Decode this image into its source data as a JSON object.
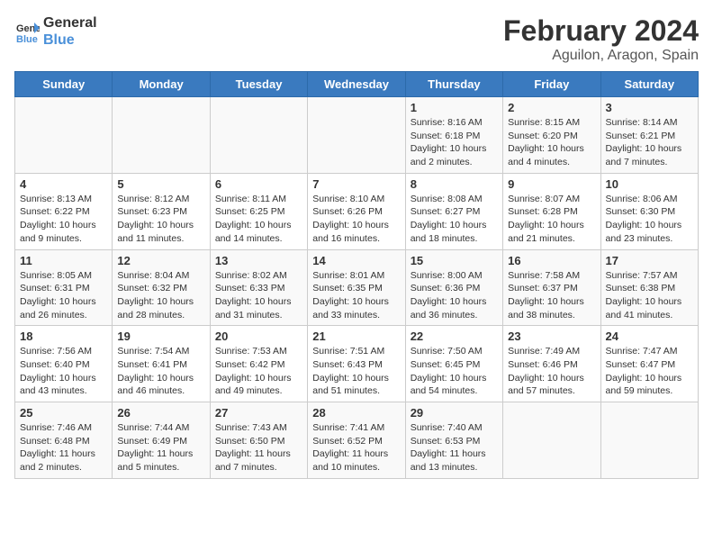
{
  "header": {
    "logo_line1": "General",
    "logo_line2": "Blue",
    "month_year": "February 2024",
    "location": "Aguilon, Aragon, Spain"
  },
  "weekdays": [
    "Sunday",
    "Monday",
    "Tuesday",
    "Wednesday",
    "Thursday",
    "Friday",
    "Saturday"
  ],
  "weeks": [
    [
      {
        "day": "",
        "info": ""
      },
      {
        "day": "",
        "info": ""
      },
      {
        "day": "",
        "info": ""
      },
      {
        "day": "",
        "info": ""
      },
      {
        "day": "1",
        "info": "Sunrise: 8:16 AM\nSunset: 6:18 PM\nDaylight: 10 hours\nand 2 minutes."
      },
      {
        "day": "2",
        "info": "Sunrise: 8:15 AM\nSunset: 6:20 PM\nDaylight: 10 hours\nand 4 minutes."
      },
      {
        "day": "3",
        "info": "Sunrise: 8:14 AM\nSunset: 6:21 PM\nDaylight: 10 hours\nand 7 minutes."
      }
    ],
    [
      {
        "day": "4",
        "info": "Sunrise: 8:13 AM\nSunset: 6:22 PM\nDaylight: 10 hours\nand 9 minutes."
      },
      {
        "day": "5",
        "info": "Sunrise: 8:12 AM\nSunset: 6:23 PM\nDaylight: 10 hours\nand 11 minutes."
      },
      {
        "day": "6",
        "info": "Sunrise: 8:11 AM\nSunset: 6:25 PM\nDaylight: 10 hours\nand 14 minutes."
      },
      {
        "day": "7",
        "info": "Sunrise: 8:10 AM\nSunset: 6:26 PM\nDaylight: 10 hours\nand 16 minutes."
      },
      {
        "day": "8",
        "info": "Sunrise: 8:08 AM\nSunset: 6:27 PM\nDaylight: 10 hours\nand 18 minutes."
      },
      {
        "day": "9",
        "info": "Sunrise: 8:07 AM\nSunset: 6:28 PM\nDaylight: 10 hours\nand 21 minutes."
      },
      {
        "day": "10",
        "info": "Sunrise: 8:06 AM\nSunset: 6:30 PM\nDaylight: 10 hours\nand 23 minutes."
      }
    ],
    [
      {
        "day": "11",
        "info": "Sunrise: 8:05 AM\nSunset: 6:31 PM\nDaylight: 10 hours\nand 26 minutes."
      },
      {
        "day": "12",
        "info": "Sunrise: 8:04 AM\nSunset: 6:32 PM\nDaylight: 10 hours\nand 28 minutes."
      },
      {
        "day": "13",
        "info": "Sunrise: 8:02 AM\nSunset: 6:33 PM\nDaylight: 10 hours\nand 31 minutes."
      },
      {
        "day": "14",
        "info": "Sunrise: 8:01 AM\nSunset: 6:35 PM\nDaylight: 10 hours\nand 33 minutes."
      },
      {
        "day": "15",
        "info": "Sunrise: 8:00 AM\nSunset: 6:36 PM\nDaylight: 10 hours\nand 36 minutes."
      },
      {
        "day": "16",
        "info": "Sunrise: 7:58 AM\nSunset: 6:37 PM\nDaylight: 10 hours\nand 38 minutes."
      },
      {
        "day": "17",
        "info": "Sunrise: 7:57 AM\nSunset: 6:38 PM\nDaylight: 10 hours\nand 41 minutes."
      }
    ],
    [
      {
        "day": "18",
        "info": "Sunrise: 7:56 AM\nSunset: 6:40 PM\nDaylight: 10 hours\nand 43 minutes."
      },
      {
        "day": "19",
        "info": "Sunrise: 7:54 AM\nSunset: 6:41 PM\nDaylight: 10 hours\nand 46 minutes."
      },
      {
        "day": "20",
        "info": "Sunrise: 7:53 AM\nSunset: 6:42 PM\nDaylight: 10 hours\nand 49 minutes."
      },
      {
        "day": "21",
        "info": "Sunrise: 7:51 AM\nSunset: 6:43 PM\nDaylight: 10 hours\nand 51 minutes."
      },
      {
        "day": "22",
        "info": "Sunrise: 7:50 AM\nSunset: 6:45 PM\nDaylight: 10 hours\nand 54 minutes."
      },
      {
        "day": "23",
        "info": "Sunrise: 7:49 AM\nSunset: 6:46 PM\nDaylight: 10 hours\nand 57 minutes."
      },
      {
        "day": "24",
        "info": "Sunrise: 7:47 AM\nSunset: 6:47 PM\nDaylight: 10 hours\nand 59 minutes."
      }
    ],
    [
      {
        "day": "25",
        "info": "Sunrise: 7:46 AM\nSunset: 6:48 PM\nDaylight: 11 hours\nand 2 minutes."
      },
      {
        "day": "26",
        "info": "Sunrise: 7:44 AM\nSunset: 6:49 PM\nDaylight: 11 hours\nand 5 minutes."
      },
      {
        "day": "27",
        "info": "Sunrise: 7:43 AM\nSunset: 6:50 PM\nDaylight: 11 hours\nand 7 minutes."
      },
      {
        "day": "28",
        "info": "Sunrise: 7:41 AM\nSunset: 6:52 PM\nDaylight: 11 hours\nand 10 minutes."
      },
      {
        "day": "29",
        "info": "Sunrise: 7:40 AM\nSunset: 6:53 PM\nDaylight: 11 hours\nand 13 minutes."
      },
      {
        "day": "",
        "info": ""
      },
      {
        "day": "",
        "info": ""
      }
    ]
  ]
}
